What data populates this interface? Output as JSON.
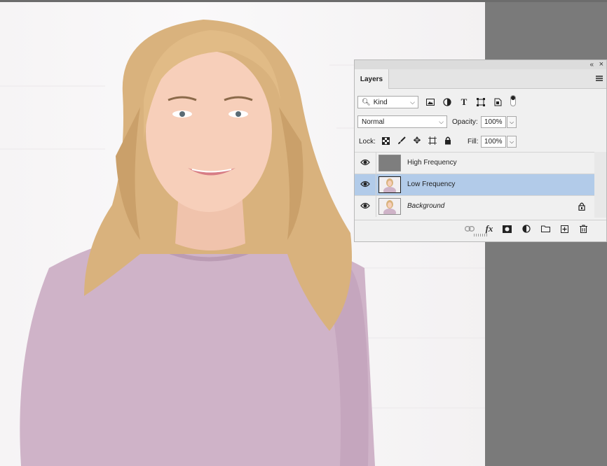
{
  "panel": {
    "tab_label": "Layers",
    "collapse_icon": "double-chevron-left-icon",
    "close_icon": "close-icon",
    "filter": {
      "value": "Kind"
    },
    "blend_mode": {
      "value": "Normal"
    },
    "opacity": {
      "label": "Opacity:",
      "value": "100%"
    },
    "lock_label": "Lock:",
    "fill": {
      "label": "Fill:",
      "value": "100%"
    },
    "layers": [
      {
        "name": "High Frequency",
        "visible": true,
        "selected": false,
        "locked": false,
        "italic": false
      },
      {
        "name": "Low Frequency",
        "visible": true,
        "selected": true,
        "locked": false,
        "italic": false
      },
      {
        "name": "Background",
        "visible": true,
        "selected": false,
        "locked": true,
        "italic": true
      }
    ]
  },
  "colors": {
    "workspace": "#7a7a7a",
    "panel_bg": "#f0f0f0",
    "selected_row": "#b2cbe9"
  }
}
